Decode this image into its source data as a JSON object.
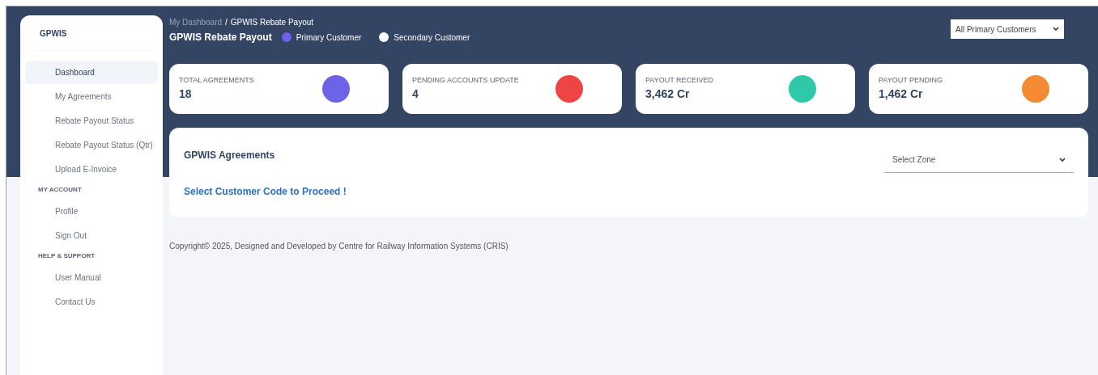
{
  "sidebar": {
    "title": "GPWIS",
    "sections": [
      {
        "items": [
          {
            "label": "Dashboard",
            "selected": true
          },
          {
            "label": "My Agreements",
            "selected": false
          },
          {
            "label": "Rebate Payout Status",
            "selected": false
          },
          {
            "label": "Rebate Payout Status (Qtr)",
            "selected": false
          },
          {
            "label": "Upload E-Invoice",
            "selected": false
          }
        ]
      },
      {
        "heading": "MY ACCOUNT",
        "items": [
          {
            "label": "Profile",
            "selected": false
          },
          {
            "label": "Sign Out",
            "selected": false
          }
        ]
      },
      {
        "heading": "HELP & SUPPORT",
        "items": [
          {
            "label": "User Manual",
            "selected": false
          },
          {
            "label": "Contact Us",
            "selected": false
          }
        ]
      }
    ]
  },
  "breadcrumb": [
    "My Dashboard",
    "/",
    "GPWIS Rebate Payout"
  ],
  "page_title": "GPWIS Rebate Payout",
  "legend": [
    {
      "label": "Primary Customer",
      "color": "#6c63e8"
    },
    {
      "label": "Secondary Customer",
      "color": "#ffffff"
    }
  ],
  "customer_filter": {
    "value": "All Primary Customers"
  },
  "stats": [
    {
      "label": "TOTAL AGREEMENTS",
      "value": "18",
      "color": "#6c63e8"
    },
    {
      "label": "PENDING ACCOUNTS UPDATE",
      "value": "4",
      "color": "#ef4444"
    },
    {
      "label": "PAYOUT RECEIVED",
      "value": "3,462 Cr",
      "color": "#2dc9a8"
    },
    {
      "label": "PAYOUT PENDING",
      "value": "1,462 Cr",
      "color": "#f58a35"
    }
  ],
  "agreements": {
    "title": "GPWIS Agreements",
    "zone_select": {
      "placeholder": "Select Zone"
    },
    "message": "Select Customer Code to Proceed !"
  },
  "footer": "Copyright© 2025, Designed and Developed by Centre for Railway Information Systems (CRIS)"
}
